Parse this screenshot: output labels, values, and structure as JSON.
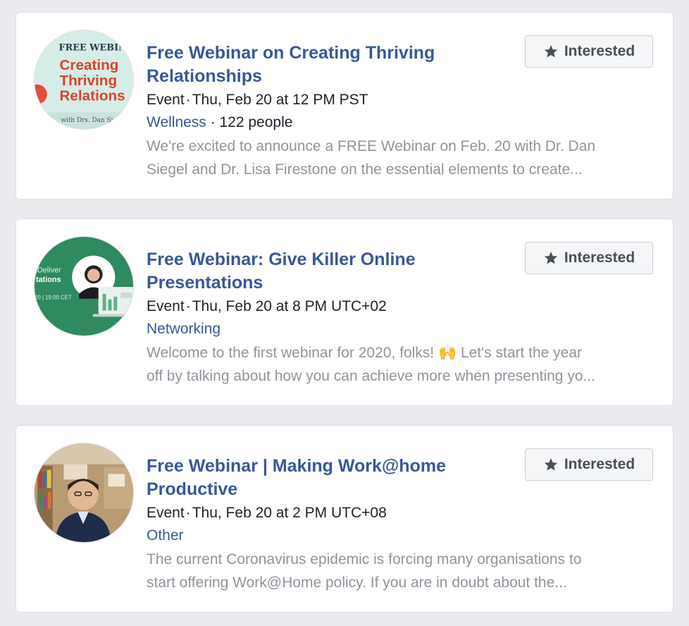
{
  "events": [
    {
      "title": "Free Webinar on Creating Thriving Relationships",
      "type": "Event",
      "date": "Thu, Feb 20 at 12 PM PST",
      "category": "Wellness",
      "people": "122 people",
      "description_line1": "We're excited to announce a FREE Webinar on Feb. 20 with Dr. Dan",
      "description_line2": "Siegel and Dr. Lisa Firestone on the essential elements to create...",
      "button_label": "Interested",
      "thumb": {
        "header": "FREE WEBINA",
        "line1": "Creating",
        "line2": "Thriving",
        "line3": "Relations",
        "footer": "with Drs. Dan Siegel"
      }
    },
    {
      "title": "Free Webinar: Give Killer Online Presentations",
      "type": "Event",
      "date": "Thu, Feb 20 at 8 PM UTC+02",
      "category": "Networking",
      "description_line1": "Welcome to the first webinar for 2020, folks! 🙌  Let's start the year",
      "description_line2": "off by talking about how you can achieve more when presenting yo...",
      "button_label": "Interested",
      "thumb": {
        "line1": "Deliver",
        "line2": "tations",
        "line3": "20 | 19:00 CET"
      }
    },
    {
      "title": "Free Webinar | Making Work@home Productive",
      "type": "Event",
      "date": "Thu, Feb 20 at 2 PM UTC+08",
      "category": "Other",
      "description_line1": "The current Coronavirus epidemic is forcing many organisations to",
      "description_line2": "start offering Work@Home policy. If you are in doubt about the...",
      "button_label": "Interested"
    }
  ],
  "separator": "·",
  "colors": {
    "link": "#385898",
    "text": "#1d2129",
    "muted": "#90949c",
    "background": "#e9ebee"
  }
}
